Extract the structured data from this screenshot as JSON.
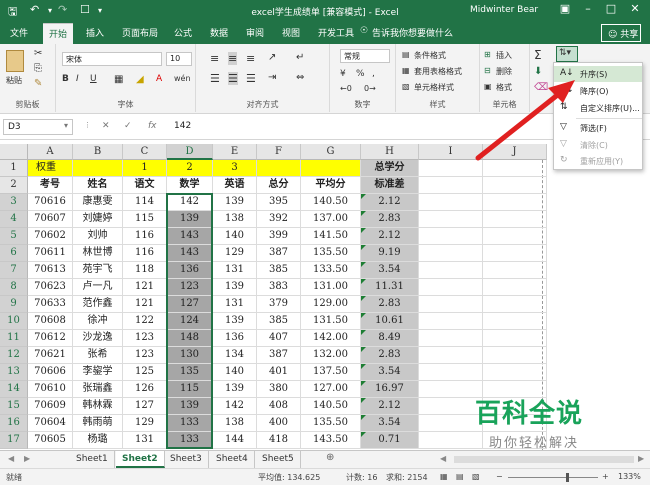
{
  "window": {
    "title": "excel学生成绩单 [兼容模式] - Excel",
    "user": "Midwinter Bear",
    "share_label": "共享",
    "quick_access_icons": [
      "save-icon",
      "undo-icon",
      "redo-icon",
      "new-doc-icon",
      "customize-icon"
    ],
    "controls": [
      "ribbon-display-icon",
      "minimize-icon",
      "maximize-icon",
      "close-icon"
    ]
  },
  "ribbon_tabs": [
    "文件",
    "开始",
    "插入",
    "页面布局",
    "公式",
    "数据",
    "审阅",
    "视图",
    "开发工具",
    "告诉我你想要做什么"
  ],
  "active_tab": "开始",
  "ribbon": {
    "clipboard": {
      "paste": "粘贴",
      "label": "剪贴板"
    },
    "font": {
      "name": "宋体",
      "size": "10",
      "bold": "B",
      "italic": "I",
      "underline": "U",
      "grow": "A",
      "shrink": "A",
      "wen": "wén",
      "label": "字体"
    },
    "alignment": {
      "label": "对齐方式"
    },
    "number": {
      "format": "常规",
      "percent": "%",
      "comma": ",",
      "label": "数字"
    },
    "styles": {
      "conditional": "条件格式",
      "table": "套用表格格式",
      "cell": "单元格样式",
      "label": "样式"
    },
    "cells": {
      "insert": "插入",
      "delete": "删除",
      "format": "格式",
      "label": "单元格"
    }
  },
  "formula_bar": {
    "name_box": "D3",
    "fx": "fx",
    "value": "142"
  },
  "sort_menu": {
    "items": [
      {
        "label": "升序(S)",
        "icon": "sort-ascending-icon",
        "disabled": false
      },
      {
        "label": "降序(O)",
        "icon": "sort-descending-icon",
        "disabled": false
      },
      {
        "label": "自定义排序(U)...",
        "icon": "custom-sort-icon",
        "disabled": false
      },
      {
        "label": "筛选(F)",
        "icon": "filter-icon",
        "disabled": false
      },
      {
        "label": "清除(C)",
        "icon": "clear-filter-icon",
        "disabled": true
      },
      {
        "label": "重新应用(Y)",
        "icon": "reapply-icon",
        "disabled": true
      }
    ]
  },
  "sheet": {
    "columns": [
      "A",
      "B",
      "C",
      "D",
      "E",
      "F",
      "G",
      "H",
      "I",
      "J"
    ],
    "rows": [
      [
        "权重",
        "",
        "1",
        "2",
        "3",
        "",
        "",
        "总学分"
      ],
      [
        "考号",
        "姓名",
        "语文",
        "数学",
        "英语",
        "总分",
        "平均分",
        "标准差"
      ],
      [
        "70616",
        "康惠雯",
        "114",
        "142",
        "139",
        "395",
        "140.50",
        "2.12"
      ],
      [
        "70607",
        "刘婕婷",
        "115",
        "139",
        "138",
        "392",
        "137.00",
        "2.83"
      ],
      [
        "70602",
        "刘帅",
        "116",
        "143",
        "140",
        "399",
        "141.50",
        "2.12"
      ],
      [
        "70611",
        "林世博",
        "116",
        "143",
        "129",
        "387",
        "135.50",
        "9.19"
      ],
      [
        "70613",
        "苑宇飞",
        "118",
        "136",
        "131",
        "385",
        "133.50",
        "3.54"
      ],
      [
        "70623",
        "卢一凡",
        "121",
        "123",
        "139",
        "383",
        "131.00",
        "11.31"
      ],
      [
        "70633",
        "范作鑫",
        "121",
        "127",
        "131",
        "379",
        "129.00",
        "2.83"
      ],
      [
        "70608",
        "徐冲",
        "122",
        "124",
        "139",
        "385",
        "131.50",
        "10.61"
      ],
      [
        "70612",
        "沙龙逸",
        "123",
        "148",
        "136",
        "407",
        "142.00",
        "8.49"
      ],
      [
        "70621",
        "张希",
        "123",
        "130",
        "134",
        "387",
        "132.00",
        "2.83"
      ],
      [
        "70606",
        "李鋆学",
        "125",
        "135",
        "140",
        "401",
        "137.50",
        "3.54"
      ],
      [
        "70610",
        "张瑞鑫",
        "126",
        "115",
        "139",
        "380",
        "127.00",
        "16.97"
      ],
      [
        "70609",
        "韩林霖",
        "127",
        "139",
        "142",
        "408",
        "140.50",
        "2.12"
      ],
      [
        "70604",
        "韩雨萌",
        "129",
        "133",
        "138",
        "400",
        "135.50",
        "3.54"
      ],
      [
        "70605",
        "杨璐",
        "131",
        "133",
        "144",
        "418",
        "143.50",
        "0.71"
      ]
    ]
  },
  "sheet_tabs": [
    "Sheet1",
    "Sheet2",
    "Sheet3",
    "Sheet4",
    "Sheet5"
  ],
  "active_sheet": "Sheet2",
  "status": {
    "mode": "就绪",
    "average": "平均值: 134.625",
    "count": "计数: 16",
    "sum": "求和: 2154",
    "zoom": "133%"
  },
  "watermark": {
    "line1": "百科全说",
    "line2": "助你轻松解决"
  },
  "colors": {
    "excel_green": "#217346",
    "highlight_yellow": "#ffff00",
    "arrow_red": "#e02020"
  }
}
